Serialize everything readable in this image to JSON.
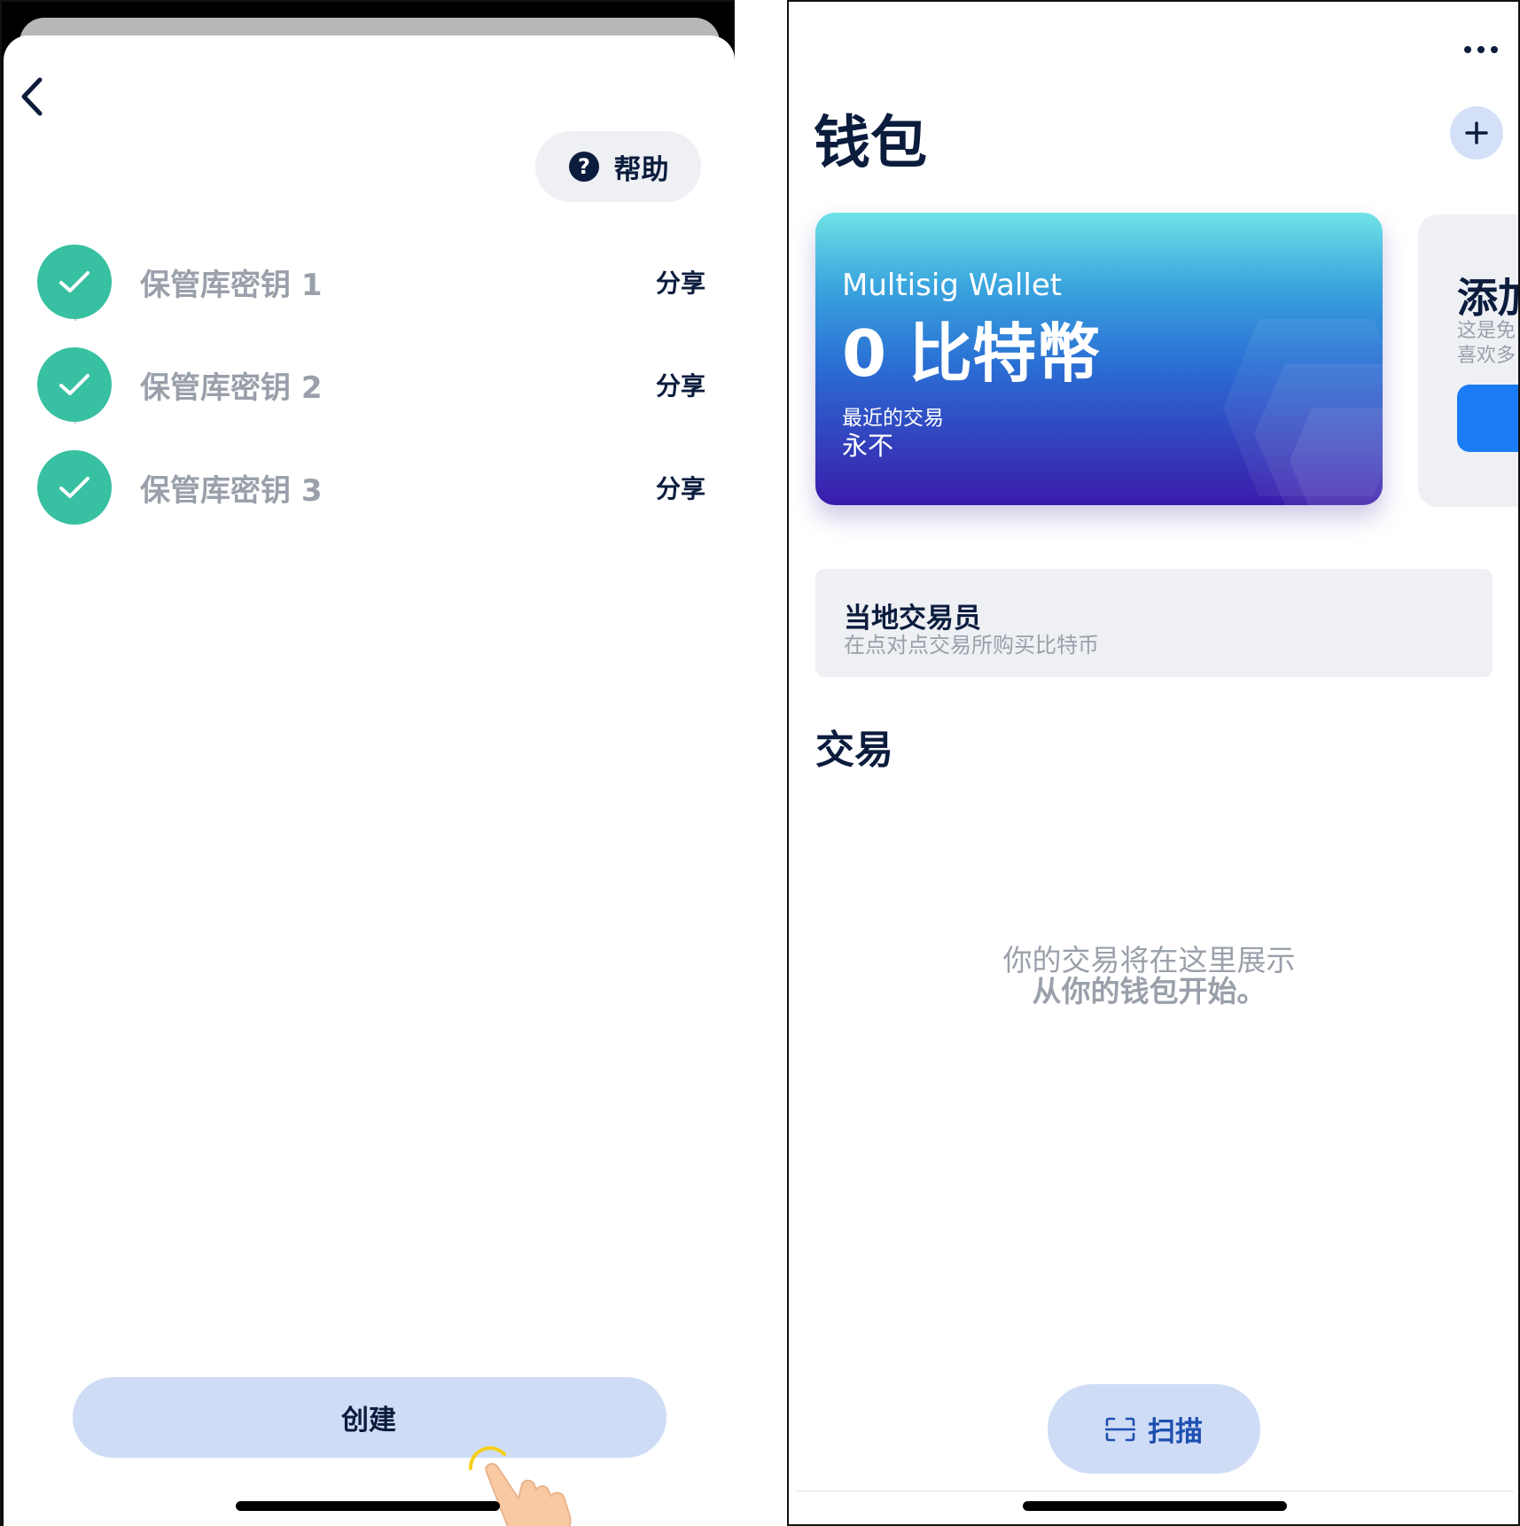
{
  "left": {
    "help_label": "帮助",
    "keys": [
      {
        "label": "保管库密钥 1",
        "share": "分享"
      },
      {
        "label": "保管库密钥 2",
        "share": "分享"
      },
      {
        "label": "保管库密钥 3",
        "share": "分享"
      }
    ],
    "create_label": "创建"
  },
  "right": {
    "title": "钱包",
    "wallet": {
      "name": "Multisig Wallet",
      "balance": "0 比特幣",
      "latest_tx_label": "最近的交易",
      "latest_tx_value": "永不"
    },
    "add_card": {
      "title": "添加",
      "subtitle_1": "这是免",
      "subtitle_2": "喜欢多"
    },
    "local_trader": {
      "title": "当地交易员",
      "subtitle": "在点对点交易所购买比特币"
    },
    "tx_header": "交易",
    "empty_line_1": "你的交易将在这里展示",
    "empty_line_2": "从你的钱包开始。",
    "scan_label": "扫描"
  },
  "colors": {
    "navy": "#0b1c3d",
    "teal_check": "#37c0a1",
    "button_bg": "#cfdcf5",
    "muted": "#9aa0aa",
    "blue_button": "#1a7cf5"
  },
  "icons": [
    "back-chevron-icon",
    "question-circle-icon",
    "check-icon",
    "tap-hand-icon",
    "more-dots-icon",
    "plus-icon",
    "scan-icon"
  ]
}
